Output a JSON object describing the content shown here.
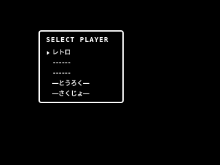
{
  "dialog": {
    "title": "SELECT PLAYER",
    "slots": [
      {
        "label": "レトロ",
        "selected": true
      },
      {
        "label": "------",
        "selected": false
      },
      {
        "label": "------",
        "selected": false
      }
    ],
    "options": [
      {
        "label": "―とうろく―"
      },
      {
        "label": "―さくじょ―"
      }
    ]
  },
  "colors": {
    "background": "#000000",
    "foreground": "#ffffff"
  },
  "icons": {
    "cursor": "cursor-arrow-icon"
  }
}
